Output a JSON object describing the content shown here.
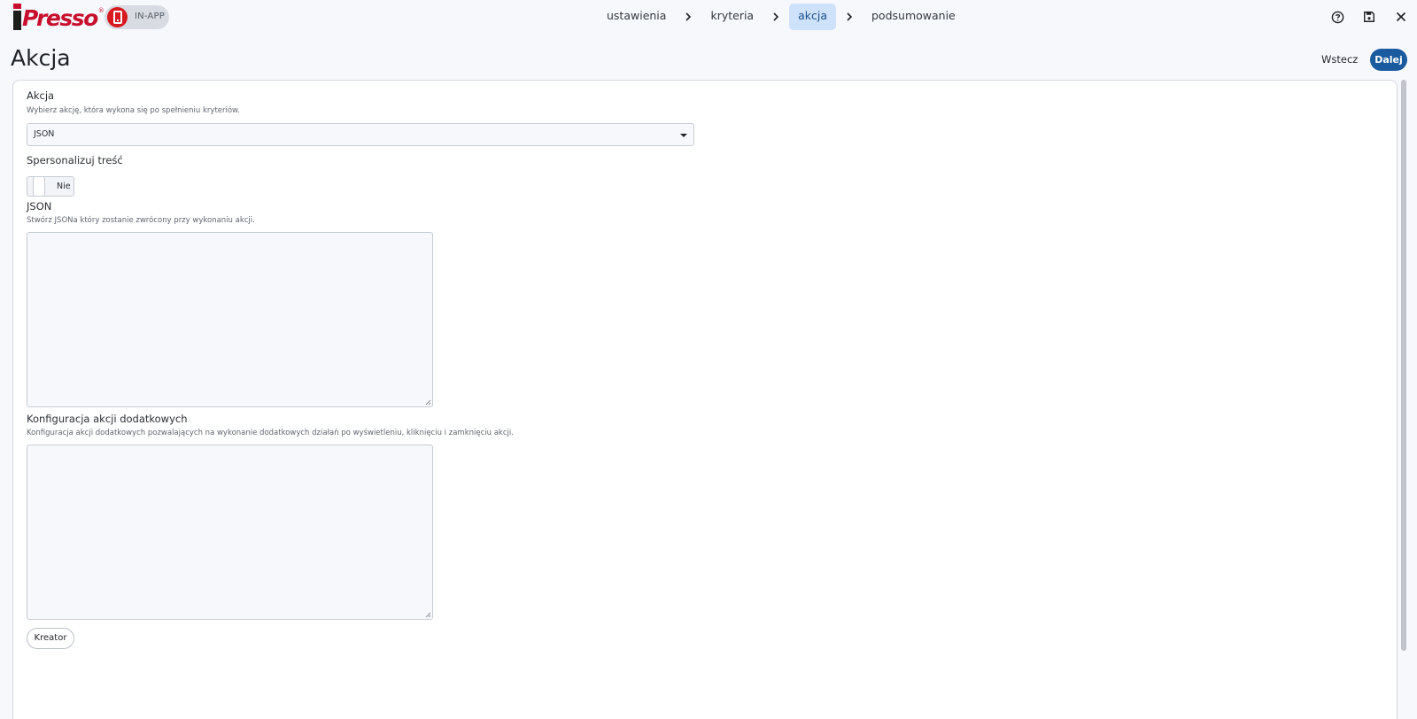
{
  "header": {
    "logo_text": "Presso",
    "logo_mark": "®",
    "campaign_type": "IN-APP",
    "steps": [
      {
        "label": "ustawienia",
        "active": false
      },
      {
        "label": "kryteria",
        "active": false
      },
      {
        "label": "akcja",
        "active": true
      },
      {
        "label": "podsumowanie",
        "active": false
      }
    ],
    "icons": [
      "help-icon",
      "save-icon",
      "close-icon"
    ]
  },
  "page": {
    "title": "Akcja",
    "back_label": "Wstecz",
    "next_label": "Dalej"
  },
  "form": {
    "action": {
      "label": "Akcja",
      "help": "Wybierz akcję, która wykona się po spełnieniu kryteriów.",
      "selected": "JSON"
    },
    "personalize": {
      "label": "Spersonalizuj treść",
      "value": "Nie"
    },
    "json": {
      "label": "JSON",
      "help": "Stwórz JSONa który zostanie zwrócony przy wykonaniu akcji.",
      "value": ""
    },
    "extra": {
      "label": "Konfiguracja akcji dodatkowych",
      "help": "Konfiguracja akcji dodatkowych pozwalających na wykonanie dodatkowych działań po wyświetleniu, kliknięciu i zamknięciu akcji.",
      "value": ""
    },
    "creator_label": "Kreator"
  },
  "colors": {
    "brand": "#c8102e",
    "primary": "#1a5a9e",
    "active_step": "#cfe2fb",
    "background": "#f6f8fc"
  }
}
